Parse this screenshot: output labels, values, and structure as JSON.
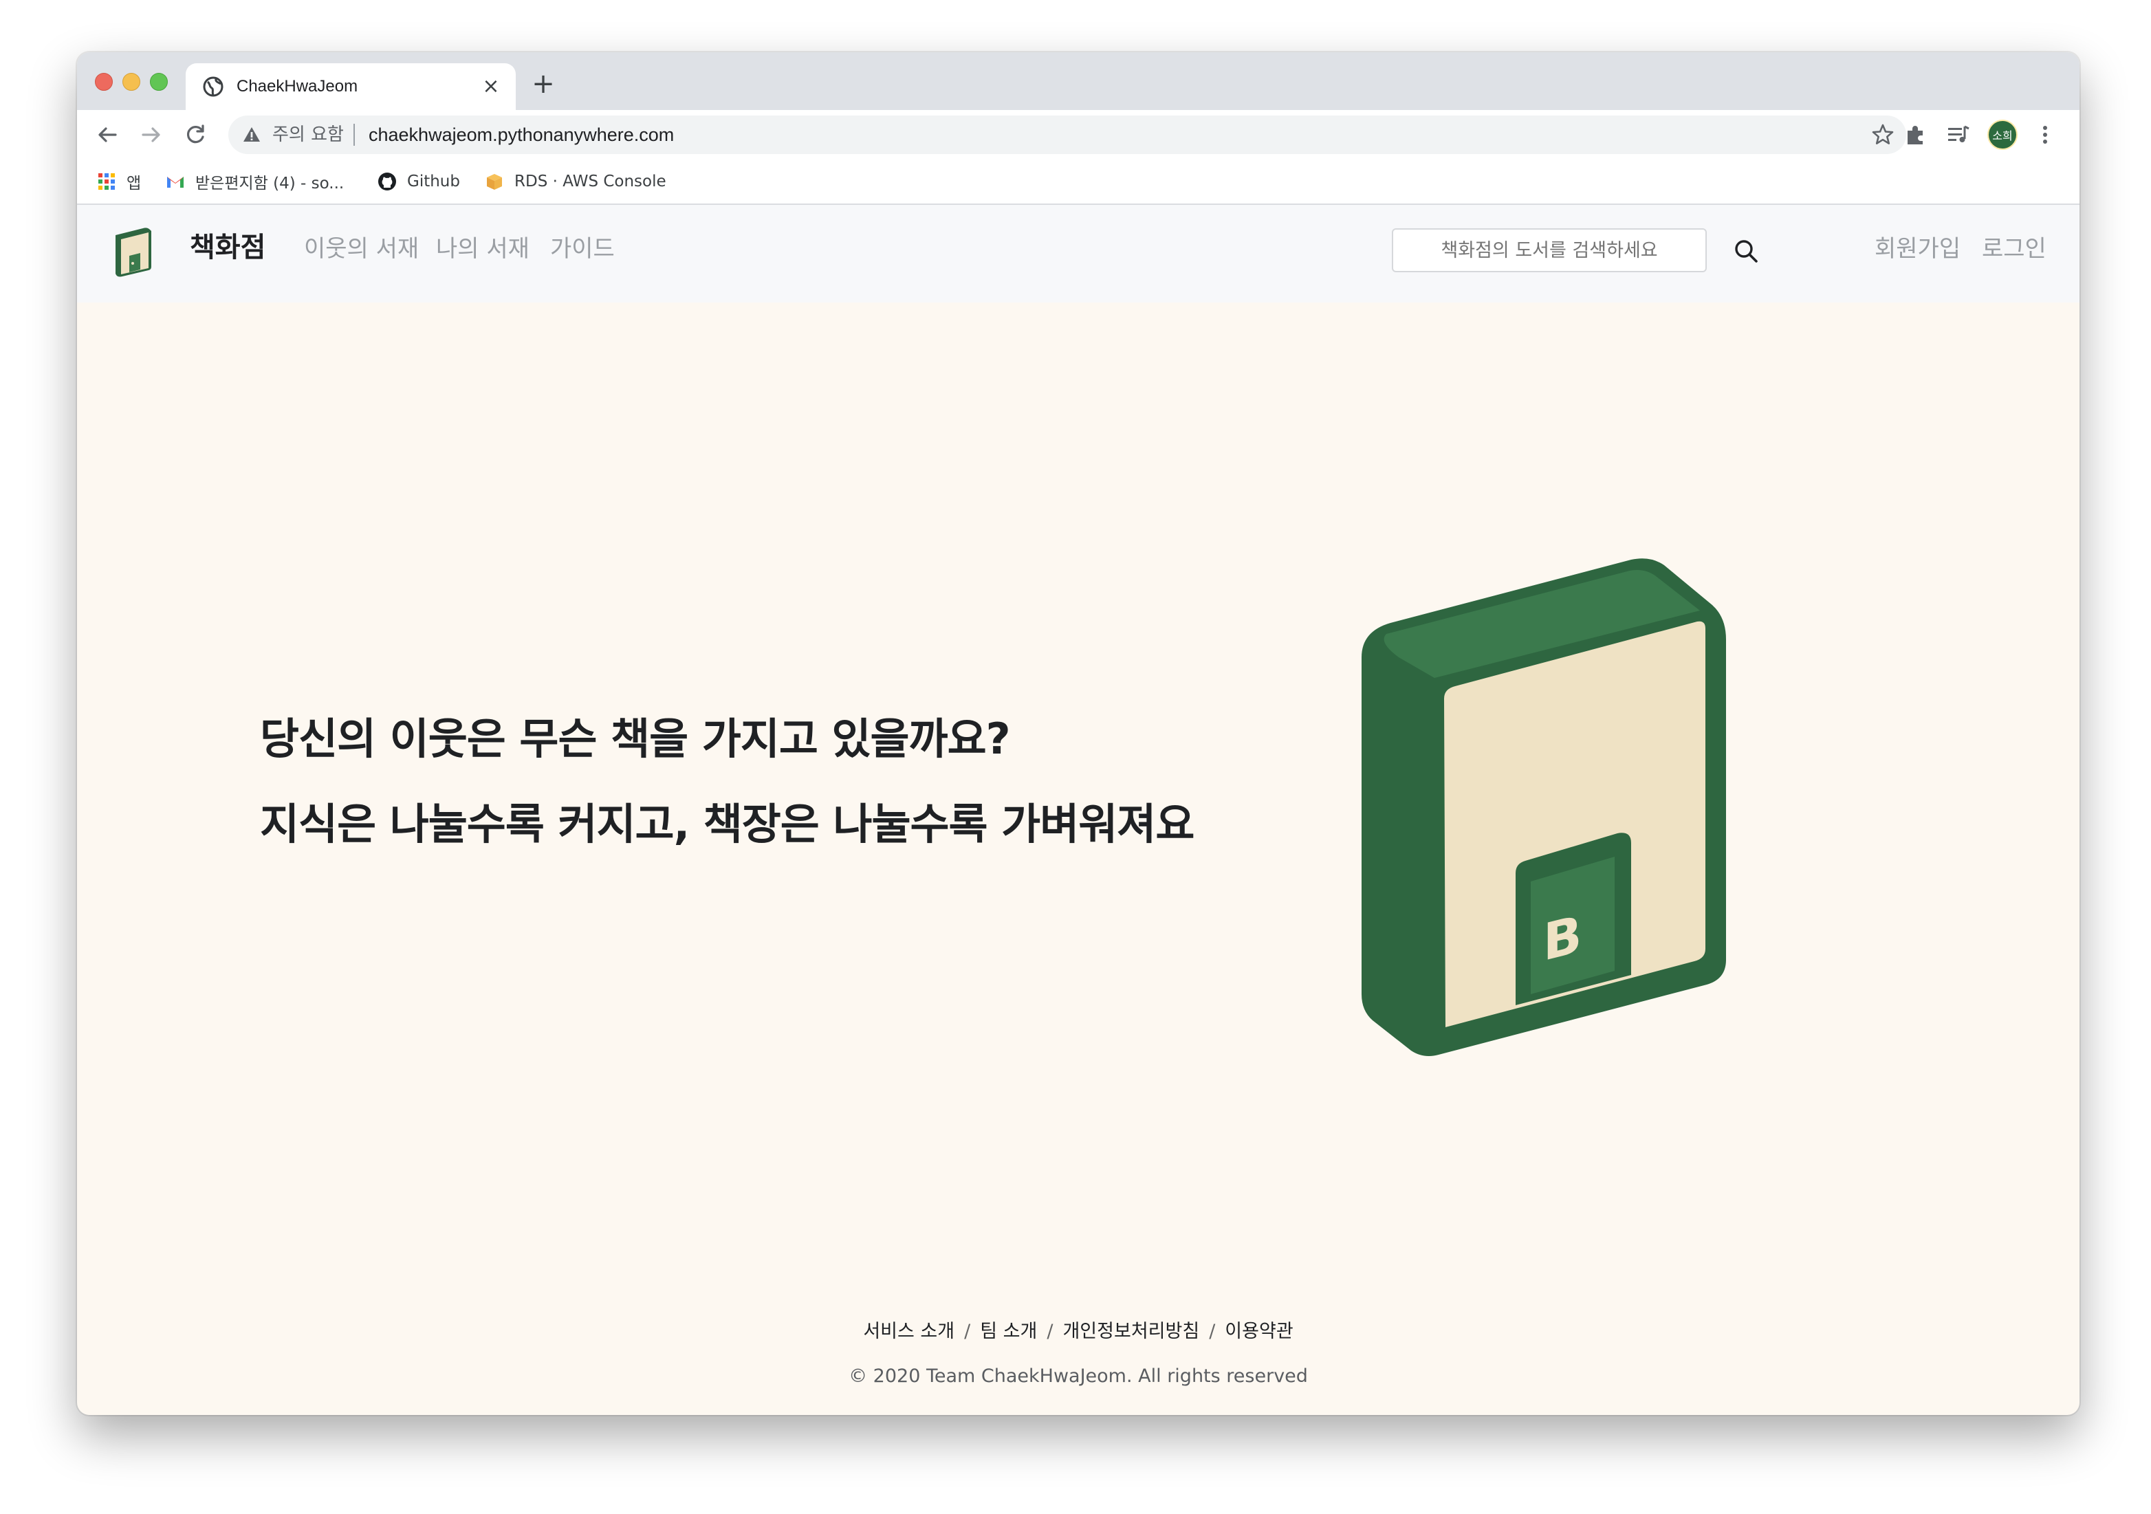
{
  "browser": {
    "tab_title": "ChaekHwaJeom",
    "new_tab": "+",
    "close_tab": "×",
    "security_label": "주의 요함",
    "url": "chaekhwajeom.pythonanywhere.com",
    "profile_label": "소희",
    "bookmarks": [
      {
        "label": "앱",
        "icon": "apps-grid-icon"
      },
      {
        "label": "받은편지함 (4) - so...",
        "icon": "gmail-icon"
      },
      {
        "label": "Github",
        "icon": "github-icon"
      },
      {
        "label": "RDS · AWS Console",
        "icon": "aws-box-icon"
      }
    ]
  },
  "site": {
    "brand": "책화점",
    "nav": [
      "이웃의 서재",
      "나의 서재",
      "가이드"
    ],
    "search_placeholder": "책화점의 도서를 검색하세요",
    "auth": [
      "회원가입",
      "로그인"
    ],
    "colors": {
      "brand_green": "#2e6640",
      "cream": "#efe2c4",
      "background": "#fdf8f1"
    }
  },
  "hero": {
    "line1": "당신의 이웃은 무슨 책을 가지고 있을까요?",
    "line2": "지식은 나눌수록 커지고, 책장은 나눌수록 가벼워져요",
    "art_letter": "B"
  },
  "footer": {
    "links": [
      "서비스 소개",
      "팀 소개",
      "개인정보처리방침",
      "이용약관"
    ],
    "separator": "/",
    "copyright": "© 2020 Team ChaekHwaJeom. All rights reserved"
  }
}
